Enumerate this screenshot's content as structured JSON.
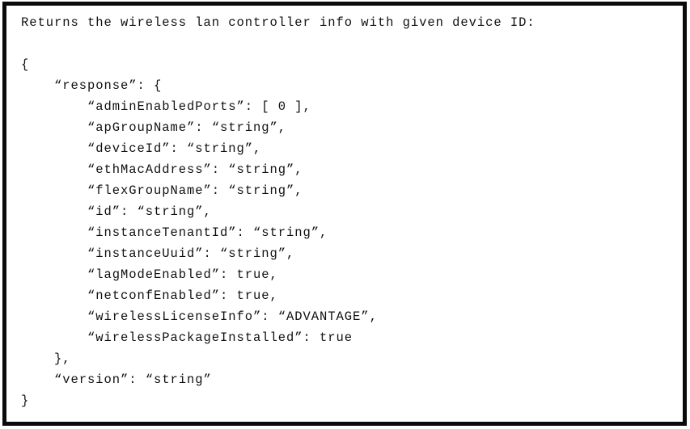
{
  "document": {
    "kind": "api-response-documentation-snippet",
    "border_color": "#0a0a0a",
    "background_color": "#ffffff",
    "text_color": "#111111"
  },
  "snippet": {
    "description_line": "Returns the wireless lan controller info with given device ID:",
    "lines": [
      "Returns the wireless lan controller info with given device ID:",
      "",
      "{",
      "    “response”: {",
      "        “adminEnabledPorts”: [ 0 ],",
      "        “apGroupName”: “string”,",
      "        “deviceId”: “string”,",
      "        “ethMacAddress”: “string”,",
      "        “flexGroupName”: “string”,",
      "        “id”: “string”,",
      "        “instanceTenantId”: “string”,",
      "        “instanceUuid”: “string”,",
      "        “lagModeEnabled”: true,",
      "        “netconfEnabled”: true,",
      "        “wirelessLicenseInfo”: “ADVANTAGE”,",
      "        “wirelessPackageInstalled”: true",
      "    },",
      "    “version”: “string”",
      "}"
    ],
    "json_fields": {
      "response": {
        "adminEnabledPorts": "[ 0 ]",
        "apGroupName": "string",
        "deviceId": "string",
        "ethMacAddress": "string",
        "flexGroupName": "string",
        "id": "string",
        "instanceTenantId": "string",
        "instanceUuid": "string",
        "lagModeEnabled": "true",
        "netconfEnabled": "true",
        "wirelessLicenseInfo": "ADVANTAGE",
        "wirelessPackageInstalled": "true"
      },
      "version": "string"
    }
  }
}
